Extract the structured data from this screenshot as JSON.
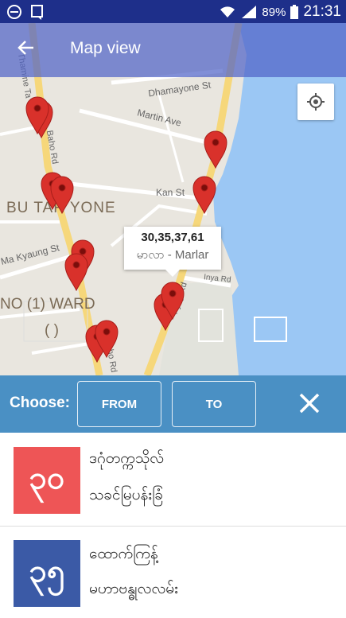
{
  "status_bar": {
    "battery": "89%",
    "time": "21:31"
  },
  "app_bar": {
    "title": "Map view",
    "back_icon": "back-arrow-icon"
  },
  "map": {
    "street_labels": [
      "Dhamayone St",
      "Martin Ave",
      "Kan St",
      "Thamine Ta",
      "Baho Rd",
      "Ma Kyaung St",
      "Inya Rd",
      "Pyay Rd",
      "Baho Rd"
    ],
    "area_labels": [
      "BU TAR YONE",
      "NO (1) WARD",
      "( )"
    ],
    "marker_count": 12,
    "tooltip": {
      "numbers": "30,35,37,61",
      "name": "မာလာ - Marlar"
    },
    "water_color": "#9bc7f4",
    "marker_color": "#d9312b",
    "road_color": "#f6d77a"
  },
  "chooser": {
    "label": "Choose:",
    "from_label": "FROM",
    "to_label": "TO",
    "close_icon": "close-icon"
  },
  "list": [
    {
      "number": "၃၀",
      "color": "#ee5556",
      "line1": "ဒဂုံတက္ကသိုလ်",
      "line2": "သခင်မြပန်းခြံ"
    },
    {
      "number": "၃၅",
      "color": "#3b5aa6",
      "line1": "ထောက်ကြန့်",
      "line2": "မဟာဗန္ဓုလလမ်း"
    }
  ]
}
